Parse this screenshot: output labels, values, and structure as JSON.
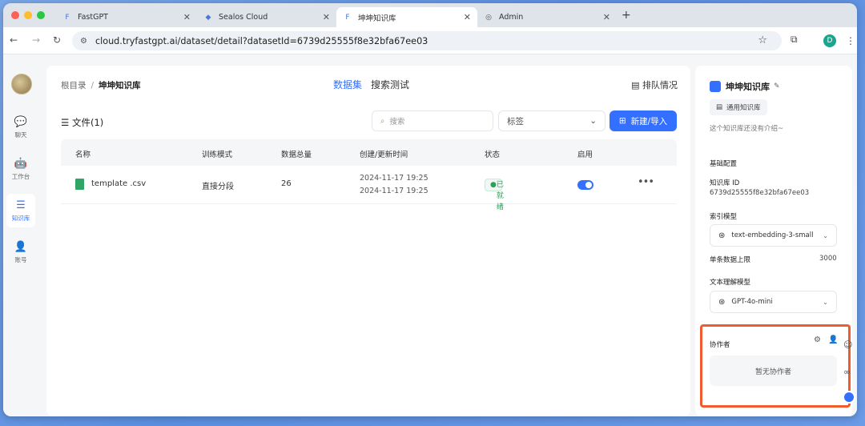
{
  "browser": {
    "tabs": [
      {
        "title": "FastGPT",
        "icon": "fastgpt-logo-icon"
      },
      {
        "title": "Sealos Cloud",
        "icon": "sealos-logo-icon"
      },
      {
        "title": "坤坤知识库",
        "icon": "fastgpt-logo-icon"
      },
      {
        "title": "Admin",
        "icon": "globe-icon"
      }
    ],
    "url": "cloud.tryfastgpt.ai/dataset/detail?datasetId=6739d25555f8e32bfa67ee03",
    "profile_initial": "D"
  },
  "sidebar": {
    "items": [
      {
        "label": "聊天",
        "icon": "chat-icon"
      },
      {
        "label": "工作台",
        "icon": "robot-icon"
      },
      {
        "label": "知识库",
        "icon": "database-icon"
      },
      {
        "label": "账号",
        "icon": "user-icon"
      }
    ]
  },
  "main": {
    "breadcrumb_root": "根目录",
    "breadcrumb_current": "坤坤知识库",
    "tabs": [
      "数据集",
      "搜索测试"
    ],
    "queue_label": "排队情况",
    "files_label": "文件(1)",
    "search_placeholder": "搜索",
    "tag_select": "标签",
    "new_button": "新建/导入",
    "columns": [
      "名称",
      "训练模式",
      "数据总量",
      "创建/更新时间",
      "状态",
      "启用"
    ],
    "rows": [
      {
        "name": "template .csv",
        "mode": "直接分段",
        "count": "26",
        "created": "2024-11-17 19:25",
        "updated": "2024-11-17 19:25",
        "status": "已就绪",
        "enabled": true
      }
    ]
  },
  "panel": {
    "title": "坤坤知识库",
    "type_chip": "通用知识库",
    "description": "这个知识库还没有介绍~",
    "basic_config": "基础配置",
    "id_label": "知识库 ID",
    "id_value": "6739d25555f8e32bfa67ee03",
    "index_model_label": "索引模型",
    "index_model": "text-embedding-3-small",
    "max_label": "单条数据上限",
    "max_value": "3000",
    "text_model_label": "文本理解模型",
    "text_model": "GPT-4o-mini",
    "collab_label": "协作者",
    "collab_empty": "暂无协作者"
  },
  "colors": {
    "accent": "#3370ff",
    "highlight": "#ef5d2f",
    "success": "#2fa05c"
  }
}
